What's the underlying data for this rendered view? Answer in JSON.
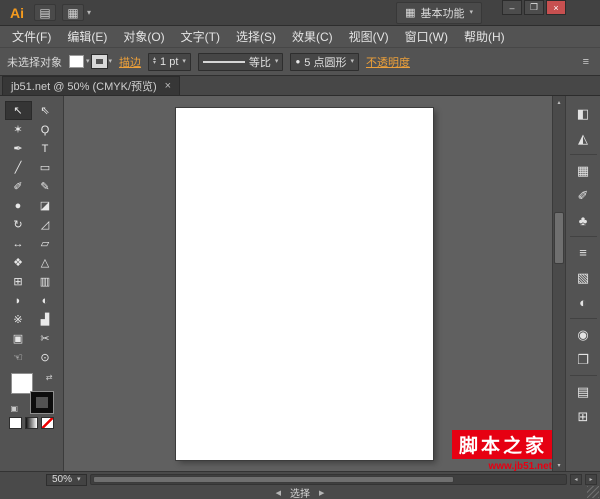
{
  "window": {
    "app_logo": "Ai",
    "workspace_button": "基本功能",
    "controls": {
      "minimize": "–",
      "restore": "❐",
      "close": "×"
    }
  },
  "titlebar_icons": [
    {
      "name": "bridge-icon",
      "glyph": "▤"
    },
    {
      "name": "arrange-documents-icon",
      "glyph": "▦"
    }
  ],
  "menubar": {
    "items": [
      {
        "key": "file",
        "label": "文件(F)"
      },
      {
        "key": "edit",
        "label": "编辑(E)"
      },
      {
        "key": "object",
        "label": "对象(O)"
      },
      {
        "key": "type",
        "label": "文字(T)"
      },
      {
        "key": "select",
        "label": "选择(S)"
      },
      {
        "key": "effect",
        "label": "效果(C)"
      },
      {
        "key": "view",
        "label": "视图(V)"
      },
      {
        "key": "window",
        "label": "窗口(W)"
      },
      {
        "key": "help",
        "label": "帮助(H)"
      }
    ]
  },
  "controlbar": {
    "no_selection_label": "未选择对象",
    "stroke_link": "描边",
    "stroke_weight": "1 pt",
    "width_profile": "等比",
    "brush_style": "5 点圆形",
    "opacity_link": "不透明度"
  },
  "document_tab": {
    "label": "jb51.net @ 50% (CMYK/预览)",
    "close_glyph": "×"
  },
  "tools": [
    {
      "name": "selection-tool",
      "glyph": "↖",
      "selected": true
    },
    {
      "name": "direct-selection-tool",
      "glyph": "⇖"
    },
    {
      "name": "magic-wand-tool",
      "glyph": "✶"
    },
    {
      "name": "lasso-tool",
      "glyph": "Ϙ"
    },
    {
      "name": "pen-tool",
      "glyph": "✒"
    },
    {
      "name": "type-tool",
      "glyph": "T"
    },
    {
      "name": "line-segment-tool",
      "glyph": "╱"
    },
    {
      "name": "rectangle-tool",
      "glyph": "▭"
    },
    {
      "name": "paintbrush-tool",
      "glyph": "✐"
    },
    {
      "name": "pencil-tool",
      "glyph": "✎"
    },
    {
      "name": "blob-brush-tool",
      "glyph": "●"
    },
    {
      "name": "eraser-tool",
      "glyph": "◪"
    },
    {
      "name": "rotate-tool",
      "glyph": "↻"
    },
    {
      "name": "scale-tool",
      "glyph": "◿"
    },
    {
      "name": "width-tool",
      "glyph": "↔"
    },
    {
      "name": "free-transform-tool",
      "glyph": "▱"
    },
    {
      "name": "shape-builder-tool",
      "glyph": "❖"
    },
    {
      "name": "perspective-grid-tool",
      "glyph": "△"
    },
    {
      "name": "mesh-tool",
      "glyph": "⊞"
    },
    {
      "name": "gradient-tool",
      "glyph": "▥"
    },
    {
      "name": "eyedropper-tool",
      "glyph": "◗"
    },
    {
      "name": "blend-tool",
      "glyph": "◐"
    },
    {
      "name": "symbol-sprayer-tool",
      "glyph": "※"
    },
    {
      "name": "column-graph-tool",
      "glyph": "▟"
    },
    {
      "name": "artboard-tool",
      "glyph": "▣"
    },
    {
      "name": "slice-tool",
      "glyph": "✂"
    },
    {
      "name": "hand-tool",
      "glyph": "☜"
    },
    {
      "name": "zoom-tool",
      "glyph": "⊙"
    }
  ],
  "panel_groups": [
    [
      {
        "name": "color-panel-icon",
        "glyph": "◧"
      },
      {
        "name": "color-guide-panel-icon",
        "glyph": "◭"
      }
    ],
    [
      {
        "name": "swatches-panel-icon",
        "glyph": "▦"
      },
      {
        "name": "brushes-panel-icon",
        "glyph": "✐"
      },
      {
        "name": "symbols-panel-icon",
        "glyph": "♣"
      }
    ],
    [
      {
        "name": "stroke-panel-icon",
        "glyph": "≡"
      },
      {
        "name": "gradient-panel-icon",
        "glyph": "▧"
      },
      {
        "name": "transparency-panel-icon",
        "glyph": "◐"
      }
    ],
    [
      {
        "name": "appearance-panel-icon",
        "glyph": "◉"
      },
      {
        "name": "graphic-styles-panel-icon",
        "glyph": "❐"
      }
    ],
    [
      {
        "name": "layers-panel-icon",
        "glyph": "▤"
      },
      {
        "name": "artboards-panel-icon",
        "glyph": "⊞"
      }
    ]
  ],
  "statusbar": {
    "zoom": "50%",
    "status": "选择"
  },
  "watermark": {
    "title": "脚本之家",
    "url": "www.jb51.net"
  },
  "colors": {
    "accent_orange": "#eda03a",
    "close_red": "#c75050",
    "watermark_red": "#e60012",
    "artboard_white": "#ffffff",
    "canvas_gray": "#606060"
  },
  "icons": {
    "caret": "▾",
    "up": "▴",
    "down": "▾",
    "left_small": "◂",
    "right_small": "▸",
    "left": "◀",
    "right": "▶",
    "swap": "⇄",
    "default_colors": "▣",
    "panel_menu": "≡",
    "bullet": "●"
  }
}
